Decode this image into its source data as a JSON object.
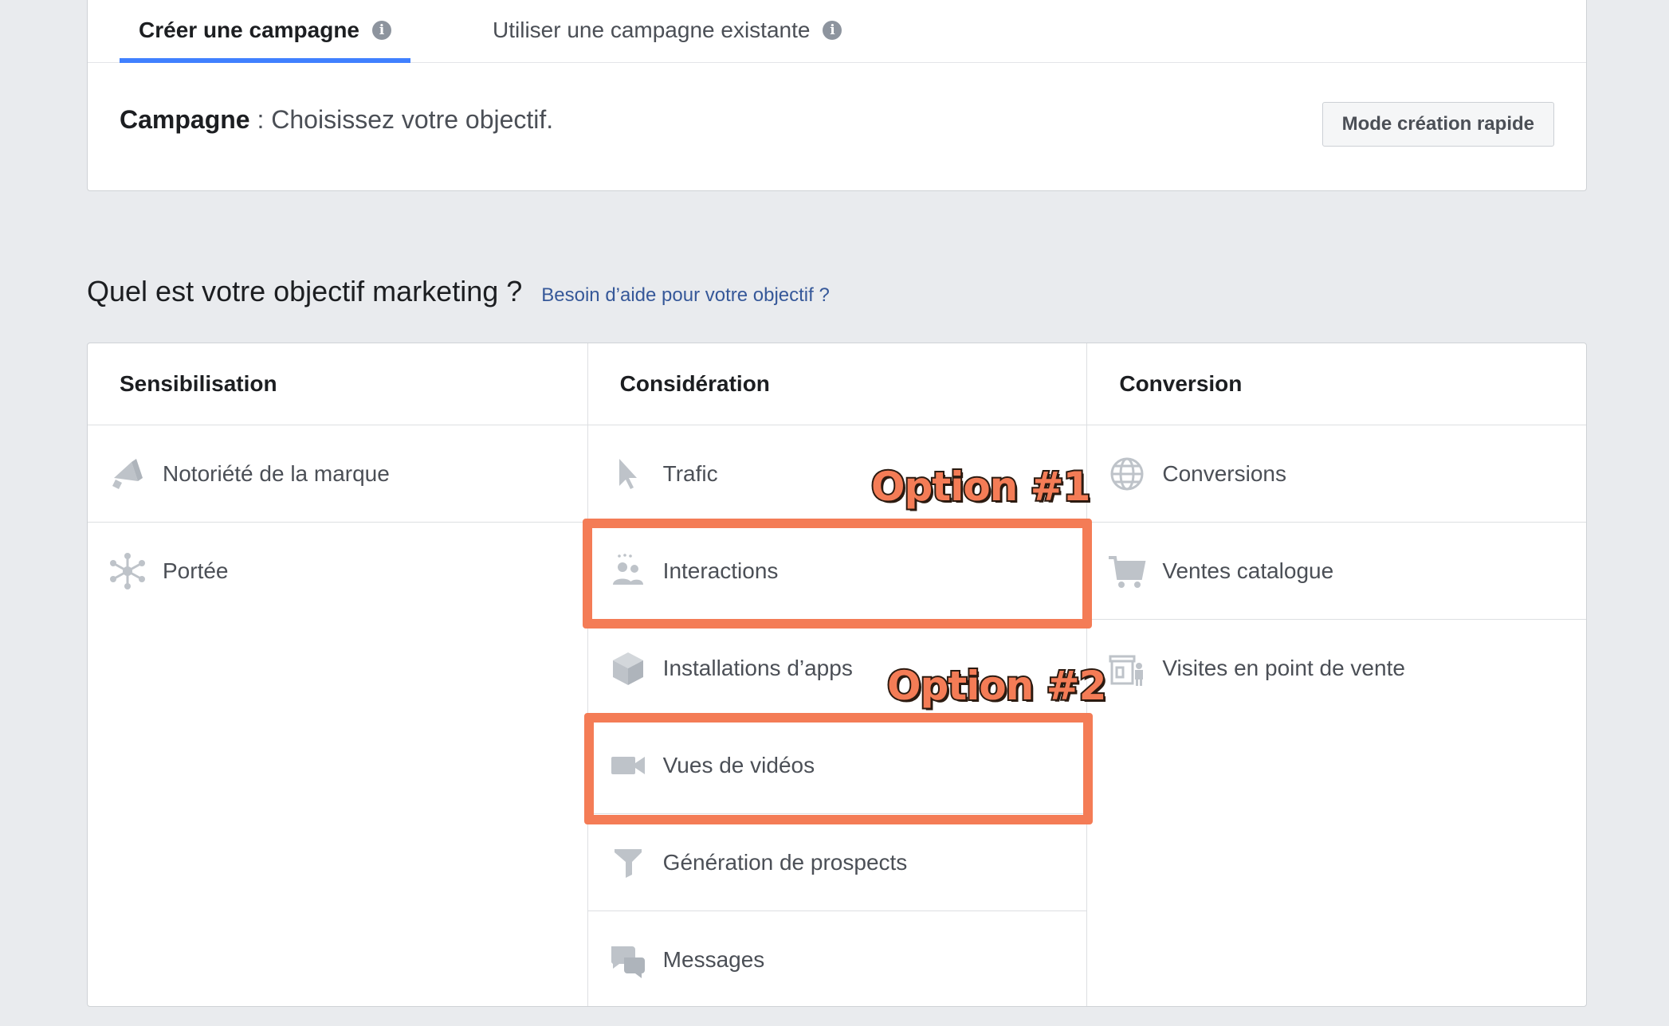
{
  "tabs": [
    {
      "label": "Créer une campagne",
      "active": true,
      "icon": "info-icon"
    },
    {
      "label": "Utiliser une campagne existante",
      "active": false,
      "icon": "info-icon"
    }
  ],
  "campaign": {
    "label": "Campagne",
    "separator": " : ",
    "prompt": "Choisissez votre objectif."
  },
  "quick_mode_button": "Mode création rapide",
  "question": {
    "text": "Quel est votre objectif marketing ?",
    "help_link": "Besoin d’aide pour votre objectif ?"
  },
  "columns": [
    {
      "header": "Sensibilisation",
      "items": [
        {
          "label": "Notoriété de la marque",
          "icon": "megaphone-icon"
        },
        {
          "label": "Portée",
          "icon": "reach-icon"
        }
      ]
    },
    {
      "header": "Considération",
      "items": [
        {
          "label": "Trafic",
          "icon": "cursor-icon"
        },
        {
          "label": "Interactions",
          "icon": "people-icon"
        },
        {
          "label": "Installations d’apps",
          "icon": "box-icon"
        },
        {
          "label": "Vues de vidéos",
          "icon": "video-camera-icon"
        },
        {
          "label": "Génération de prospects",
          "icon": "funnel-icon"
        },
        {
          "label": "Messages",
          "icon": "chat-icon"
        }
      ]
    },
    {
      "header": "Conversion",
      "items": [
        {
          "label": "Conversions",
          "icon": "globe-icon"
        },
        {
          "label": "Ventes catalogue",
          "icon": "cart-icon"
        },
        {
          "label": "Visites en point de vente",
          "icon": "store-icon"
        }
      ]
    }
  ],
  "annotations": {
    "option1": "Option #1",
    "option2": "Option #2",
    "color": "#f47c56"
  },
  "colors": {
    "tab_underline": "#4080ff",
    "link": "#365899",
    "icon": "#bec3c9",
    "background": "#e9ebee"
  }
}
